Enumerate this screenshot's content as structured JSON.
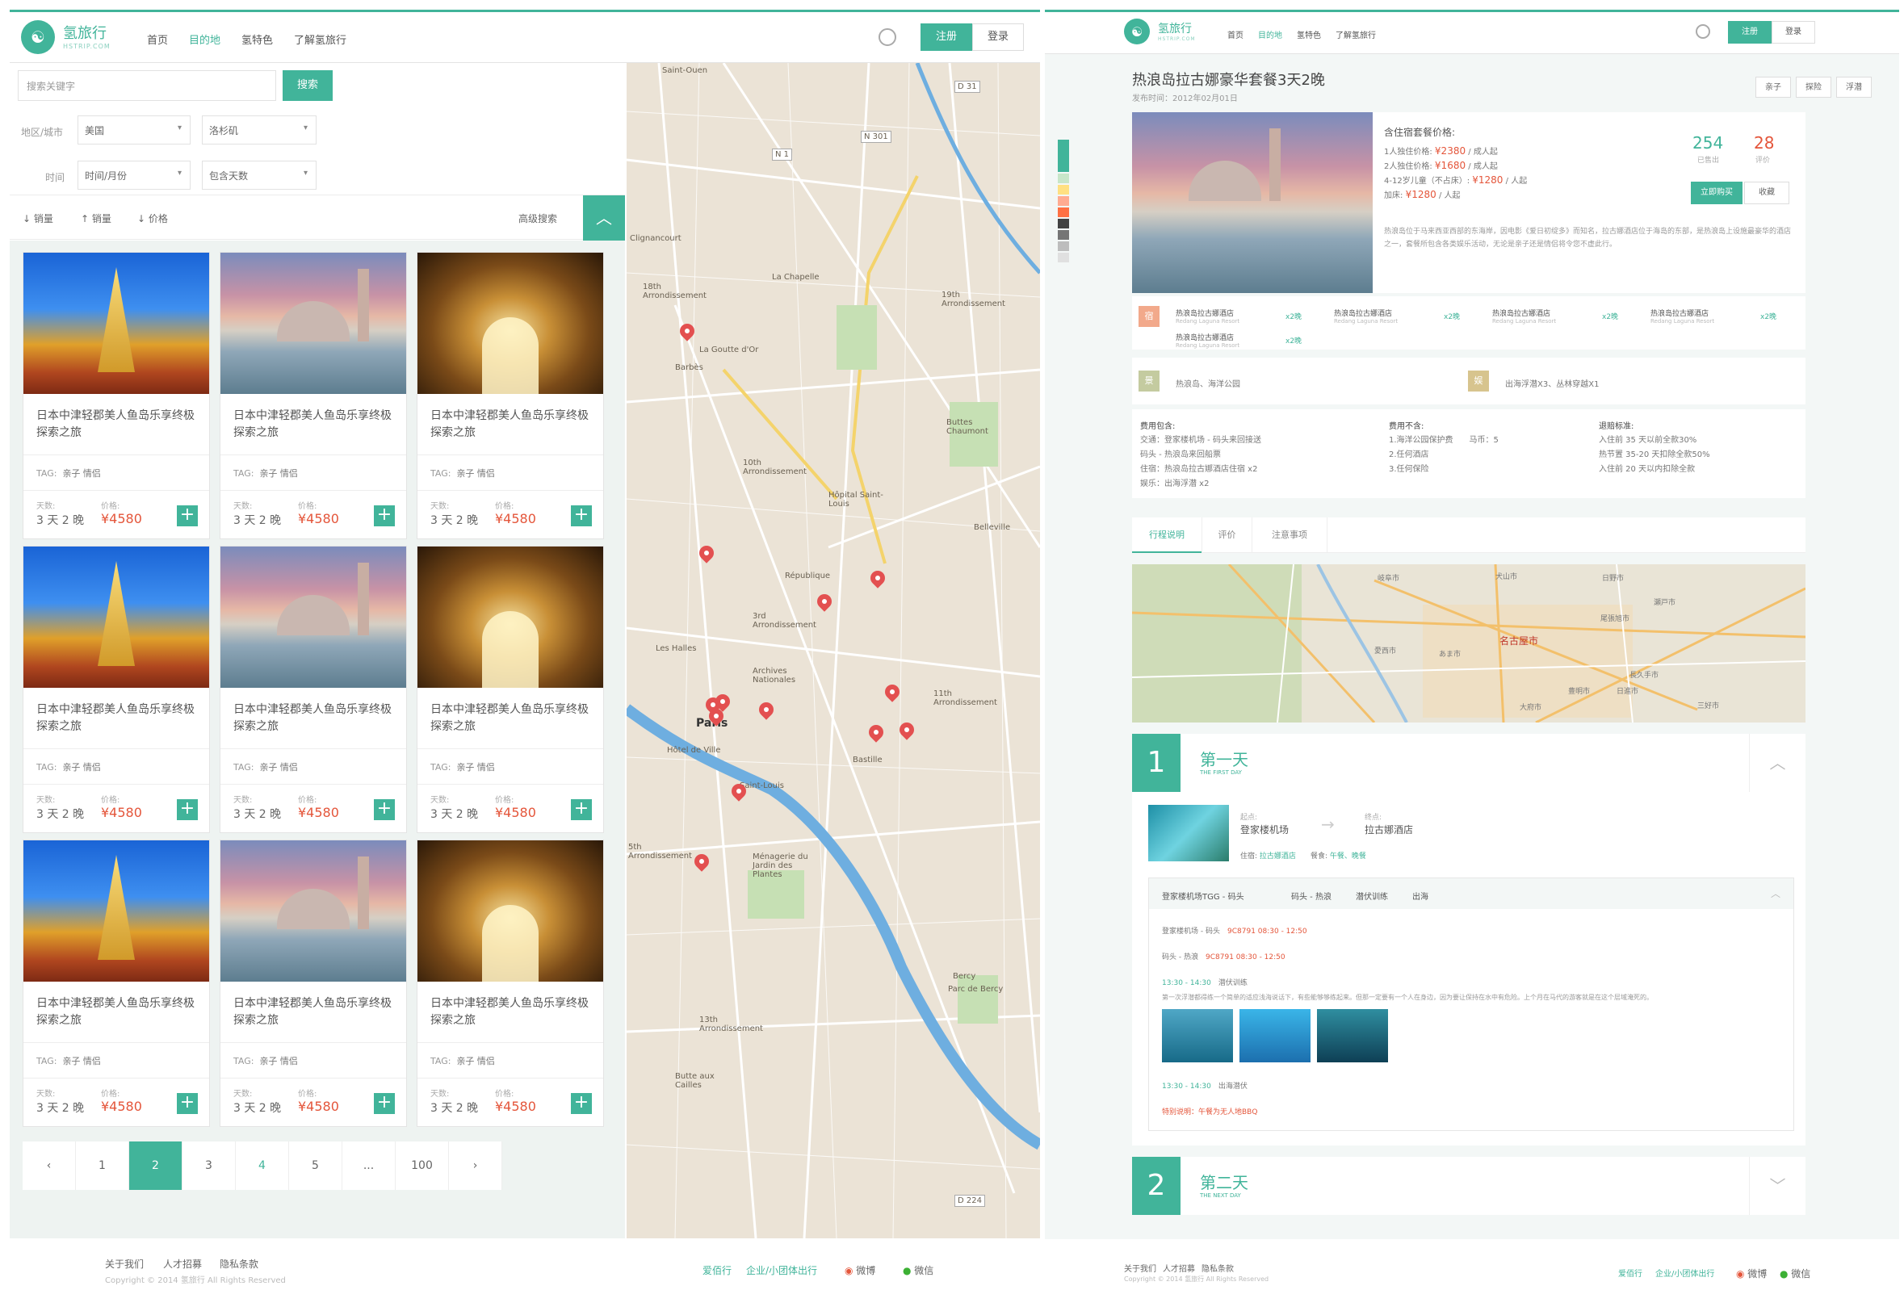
{
  "left": {
    "logo": {
      "name": "氢旅行",
      "sub": "HSTRIP.COM",
      "glyph": "☯"
    },
    "nav": [
      "首页",
      "目的地",
      "氢特色",
      "了解氢旅行"
    ],
    "nav_active_index": 1,
    "auth": {
      "register": "注册",
      "login": "登录"
    },
    "search": {
      "placeholder": "搜索关键字",
      "button": "搜索"
    },
    "filters": {
      "region_label": "地区/城市",
      "region_value": "美国",
      "city_value": "洛杉矶",
      "time_label": "时间",
      "time_value": "时间/月份",
      "days_value": "包含天数"
    },
    "sort": {
      "sales1": "↓ 销量",
      "sales2": "↑ 销量",
      "price": "↓ 价格",
      "advanced": "高级搜索"
    },
    "cards": {
      "title": "日本中津轻郡美人鱼岛乐享终极探索之旅",
      "tag_label": "TAG:",
      "tags": "亲子  情侣",
      "days_label": "天数:",
      "days": "3 天 2 晚",
      "price_label": "价格:",
      "price": "¥4580",
      "plus": "+"
    },
    "pagination": [
      "‹",
      "1",
      "2",
      "3",
      "4",
      "5",
      "...",
      "100",
      "›"
    ],
    "pagination_active": "2",
    "map_labels": [
      "La Chapelle",
      "18th Arrondissement",
      "19th Arrondissement",
      "10th Arrondissement",
      "République",
      "3rd Arrondissement",
      "Les Halles",
      "Paris",
      "Bastille",
      "11th Arrondissement",
      "Archives Nationales",
      "Hôtel de Ville",
      "Saint-Louis",
      "5th Arrondissement",
      "Ménagerie du Jardin des Plantes",
      "Bercy",
      "Parc de Bercy",
      "13th Arrondissement",
      "Butte aux Cailles",
      "Belleville",
      "Buttes Chaumont",
      "Hôpital Saint-Louis",
      "Saint-Ouen",
      "Clignancourt",
      "La Goutte d'Or",
      "Barbès",
      "D 31",
      "N 301",
      "N 1",
      "D 224"
    ],
    "footer": {
      "links": [
        "关于我们",
        "人才招募",
        "隐私条款"
      ],
      "copyright": "Copyright © 2014 氢旅行 All Rights Reserved",
      "right_links": [
        "爱佰行",
        "企业/小团体出行"
      ],
      "weibo": "微博",
      "wechat": "微信"
    }
  },
  "right": {
    "logo": {
      "name": "氢旅行",
      "sub": "HSTRIP.COM",
      "glyph": "☯"
    },
    "nav": [
      "首页",
      "目的地",
      "氢特色",
      "了解氢旅行"
    ],
    "nav_active_index": 1,
    "auth": {
      "register": "注册",
      "login": "登录"
    },
    "title": "热浪岛拉古娜豪华套餐3天2晚",
    "date": "发布时间：2012年02月01日",
    "tags": [
      "亲子",
      "探险",
      "浮潜"
    ],
    "strip_colors": [
      "#41b49a",
      "#c8e6c9",
      "#ffe082",
      "#ffab91",
      "#ff7043",
      "#424242",
      "#757575",
      "#bdbdbd",
      "#e0e0e0"
    ],
    "price": {
      "title": "含住宿套餐价格:",
      "lines": [
        {
          "label": "1人独住价格:",
          "value": "¥2380",
          "unit": "/ 成人起"
        },
        {
          "label": "2人独住价格:",
          "value": "¥1680",
          "unit": "/ 成人起"
        },
        {
          "label": "4-12岁儿童（不占床）:",
          "value": "¥1280",
          "unit": "/ 人起"
        },
        {
          "label": "加床:",
          "value": "¥1280",
          "unit": "/ 人起"
        }
      ],
      "sold_count": "254",
      "sold_label": "已售出",
      "review_count": "28",
      "review_label": "评价",
      "buy": "立即购买",
      "fav": "收藏"
    },
    "description": "热浪岛位于马来西亚西部的东海岸，因电影《爱日初绽多》而知名，拉古娜酒店位于海岛的东部，是热浪岛上设施最豪华的酒店之一，套餐所包含各类娱乐活动，无论是亲子还是情侣将令您不虚此行。",
    "hotels": {
      "icon": "宿",
      "items": [
        {
          "name": "热浪岛拉古娜酒店",
          "sub": "Redang Laguna Resort",
          "nights": "x2晚"
        },
        {
          "name": "热浪岛拉古娜酒店",
          "sub": "Redang Laguna Resort",
          "nights": "x2晚"
        },
        {
          "name": "热浪岛拉古娜酒店",
          "sub": "Redang Laguna Resort",
          "nights": "x2晚"
        },
        {
          "name": "热浪岛拉古娜酒店",
          "sub": "Redang Laguna Resort",
          "nights": "x2晚"
        },
        {
          "name": "热浪岛拉古娜酒店",
          "sub": "Redang Laguna Resort",
          "nights": "x2晚"
        }
      ]
    },
    "sights": {
      "icon": "景",
      "text": "热浪岛、海洋公园"
    },
    "activity": {
      "icon": "娱",
      "text": "出海浮潜X3、丛林穿越X1"
    },
    "fees": {
      "inc_title": "费用包含:",
      "inc": [
        "交通：登家楼机场 - 码头来回接送",
        "码头 - 热浪岛来回船票",
        "住宿：热浪岛拉古娜酒店住宿 x2",
        "娱乐：出海浮潜 x2"
      ],
      "exc_title": "费用不含:",
      "exc": [
        "1.海洋公园保护费　　马币：5",
        "2.任何酒店",
        "3.任何保险"
      ],
      "ref_title": "退赔标准:",
      "ref": [
        "入住前 35 天以前全款30%",
        "热节置 35-20 天扣除全款50%",
        "入住前 20 天以内扣除全款"
      ]
    },
    "tabs": [
      "行程说明",
      "评价",
      "注意事项"
    ],
    "map_labels": [
      "名古屋市",
      "岐阜市",
      "日野市",
      "瀬戸市",
      "愛西市",
      "あま市",
      "大府市",
      "豊明市",
      "尾張旭市",
      "日進市",
      "長久手市",
      "三好市",
      "犬山市"
    ],
    "day1": {
      "num": "1",
      "title": "第一天",
      "sub": "THE FIRST DAY",
      "from_label": "起点:",
      "from": "登家楼机场",
      "to_label": "终点:",
      "to": "拉古娜酒店",
      "stay_label": "住宿:",
      "stay": "拉古娜酒店",
      "meal_label": "餐食:",
      "meal": "午餐、晚餐",
      "route": [
        "登家楼机场TGG - 码头",
        "码头 - 热浪",
        "潜伏训练",
        "出海"
      ],
      "seg1": "登家楼机场 - 码头",
      "seg1_t": "9C8791  08:30 - 12:50",
      "seg2": "码头 - 热浪",
      "seg2_t": "9C8791  08:30 - 12:50",
      "act1_t": "13:30 - 14:30",
      "act1": "潜伏训练",
      "act1_desc": "第一次浮潜都得练一个简单的适应浅海说话下，有些能够够练起来。但那一定要有一个人在身边，因为要让保持在水中有危险。上个月在马代的游客就是在这个层域淹死的。",
      "act2_t": "13:30 - 14:30",
      "act2": "出海潜伏",
      "note": "特别说明：午餐为无人地BBQ"
    },
    "day2": {
      "num": "2",
      "title": "第二天",
      "sub": "THE NEXT DAY"
    },
    "footer": {
      "links": [
        "关于我们",
        "人才招募",
        "隐私条款"
      ],
      "copyright": "Copyright © 2014 氢旅行 All Rights Reserved",
      "right_links": [
        "爱佰行",
        "企业/小团体出行"
      ],
      "weibo": "微博",
      "wechat": "微信"
    }
  }
}
